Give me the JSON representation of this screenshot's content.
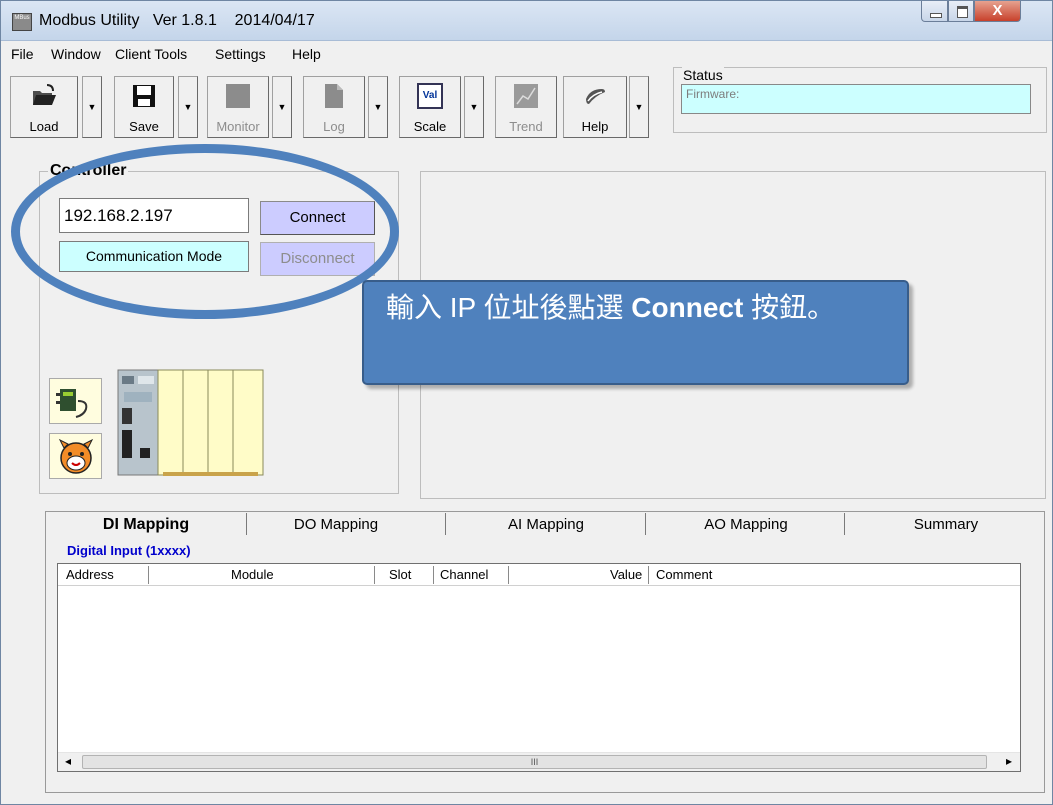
{
  "titlebar": {
    "title": "Modbus Utility   Ver 1.8.1    2014/04/17",
    "app_icon_text": "MBus",
    "close_glyph": "X"
  },
  "menu": [
    "File",
    "Window",
    "Client Tools",
    "Settings",
    "Help"
  ],
  "toolbar": {
    "load": "Load",
    "save": "Save",
    "monitor": "Monitor",
    "log": "Log",
    "scale": "Scale",
    "scale_icon": "Val",
    "trend": "Trend",
    "help": "Help",
    "dropdown_glyph": "▼"
  },
  "status": {
    "label": "Status",
    "firmware": "Firmware:"
  },
  "controller": {
    "title": "Controller",
    "ip_value": "192.168.2.197",
    "connect": "Connect",
    "disconnect": "Disconnect",
    "comm_mode": "Communication Mode"
  },
  "callout": {
    "text_prefix": "輸入 IP 位址後點選 ",
    "text_bold": "Connect",
    "text_suffix": " 按鈕。"
  },
  "tabs": [
    "DI Mapping",
    "DO Mapping",
    "AI Mapping",
    "AO Mapping",
    "Summary"
  ],
  "mapping": {
    "section_label": "Digital Input  (1xxxx)",
    "columns": [
      "Address",
      "Module",
      "Slot",
      "Channel",
      "Value",
      "Comment"
    ]
  },
  "scrollbar": {
    "left_glyph": "◂",
    "right_glyph": "▸",
    "thumb_glyph": "III"
  },
  "colors": {
    "accent": "#4f81bd",
    "status_field": "#ccffff",
    "button": "#ccccff",
    "section_label": "#0000cc"
  }
}
